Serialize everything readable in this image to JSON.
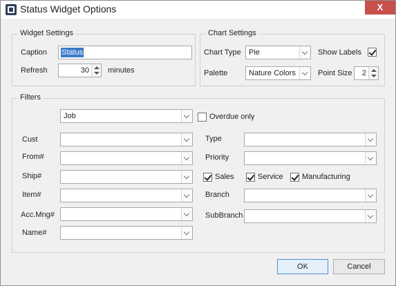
{
  "window": {
    "title": "Status Widget Options",
    "close_glyph": "X"
  },
  "widget_settings": {
    "legend": "Widget Settings",
    "caption_label": "Caption",
    "caption_value": "Status",
    "refresh_label": "Refresh",
    "refresh_value": "30",
    "refresh_unit": "minutes"
  },
  "chart_settings": {
    "legend": "Chart Settings",
    "chart_type_label": "Chart Type",
    "chart_type_value": "Pie",
    "show_labels_label": "Show Labels",
    "show_labels_checked": true,
    "palette_label": "Palette",
    "palette_value": "Nature Colors",
    "point_size_label": "Point Size",
    "point_size_value": "2"
  },
  "filters": {
    "legend": "Filters",
    "mode_value": "Job",
    "overdue_label": "Overdue only",
    "overdue_checked": false,
    "cust_label": "Cust",
    "from_label": "From#",
    "ship_label": "Ship#",
    "item_label": "Item#",
    "accmng_label": "Acc.Mng#",
    "name_label": "Name#",
    "type_label": "Type",
    "priority_label": "Priority",
    "sales_label": "Sales",
    "service_label": "Service",
    "manufacturing_label": "Manufacturing",
    "branch_label": "Branch",
    "subbranch_label": "SubBranch"
  },
  "footer": {
    "ok_label": "OK",
    "cancel_label": "Cancel"
  }
}
